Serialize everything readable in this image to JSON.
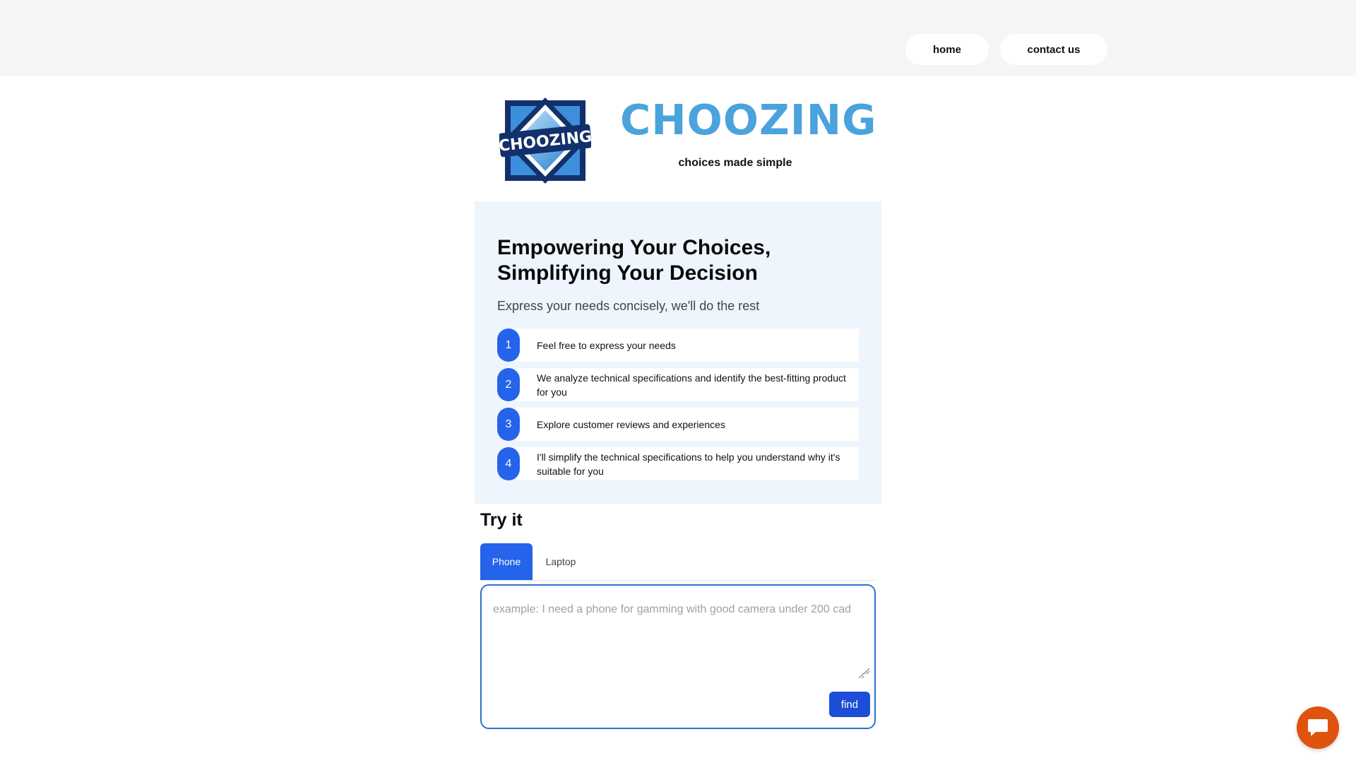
{
  "nav": {
    "home_label": "home",
    "contact_label": "contact us"
  },
  "brand": {
    "logo_text": "CHOOZING",
    "title": "CHOOZING",
    "tagline": "choices made simple",
    "title_color": "#4aa3dc"
  },
  "hero": {
    "title": "Empowering Your Choices, Simplifying Your Decision",
    "subtitle": "Express your needs concisely, we'll do the rest",
    "steps": [
      {
        "number": "1",
        "text": "Feel free to express your needs"
      },
      {
        "number": "2",
        "text": "We analyze technical specifications and identify the best-fitting product for you"
      },
      {
        "number": "3",
        "text": "Explore customer reviews and experiences"
      },
      {
        "number": "4",
        "text": "I'll simplify the technical specifications to help you understand why it's suitable for you"
      }
    ]
  },
  "try_it": {
    "title": "Try it",
    "tabs": [
      {
        "label": "Phone",
        "active": true
      },
      {
        "label": "Laptop",
        "active": false
      }
    ],
    "input_value": "",
    "input_placeholder": "example: I need a phone for gamming with good camera under 200 cad",
    "find_label": "find"
  },
  "chat": {
    "icon": "chat-bubble-icon",
    "color": "#e0530f"
  },
  "colors": {
    "accent": "#2563eb",
    "hero_bg": "#eef5fd",
    "topbar_bg": "#f5f5f5"
  }
}
